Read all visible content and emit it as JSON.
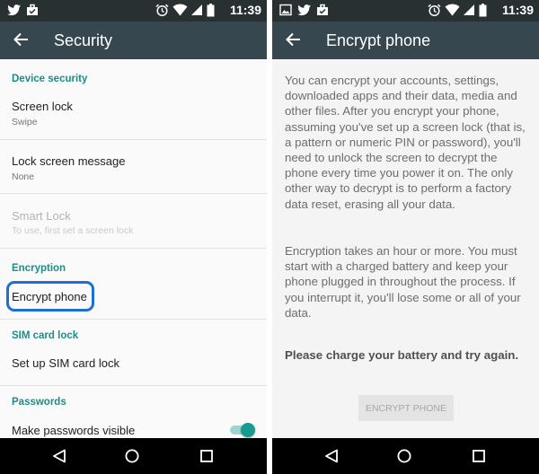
{
  "status_bar": {
    "time": "11:39",
    "icons": [
      "twitter-icon",
      "briefcase-icon",
      "alarm-icon",
      "wifi-icon",
      "signal-icon",
      "battery-icon"
    ]
  },
  "left": {
    "title": "Security",
    "sections": {
      "device_security": "Device security",
      "encryption": "Encryption",
      "sim_card_lock": "SIM card lock",
      "passwords": "Passwords"
    },
    "items": {
      "screen_lock": {
        "title": "Screen lock",
        "summary": "Swipe"
      },
      "lock_screen_message": {
        "title": "Lock screen message",
        "summary": "None"
      },
      "smart_lock": {
        "title": "Smart Lock",
        "summary": "To use, first set a screen lock"
      },
      "encrypt_phone": {
        "title": "Encrypt phone"
      },
      "sim_lock": {
        "title": "Set up SIM card lock"
      },
      "passwords_visible": {
        "title": "Make passwords visible",
        "enabled": true
      }
    }
  },
  "right": {
    "title": "Encrypt phone",
    "paragraph1": "You can encrypt your accounts, settings, downloaded apps and their data, media and other files. After you encrypt your phone, assuming you've set up a screen lock (that is, a pattern or numeric PIN or password), you'll need to unlock the screen to decrypt the phone every time you power it on. The only other way to decrypt is to perform a factory data reset, erasing all your data.",
    "paragraph2": "Encryption takes an hour or more. You must start with a charged battery and keep your phone plugged in throughout the process. If you interrupt it, you'll lose some or all of your data.",
    "warning": "Please charge your battery and try again.",
    "button_label": "ENCRYPT PHONE"
  },
  "colors": {
    "accent": "#1a8e86",
    "app_bar": "#37474f",
    "status_bar": "#283032",
    "highlight": "#1d6fd6"
  }
}
